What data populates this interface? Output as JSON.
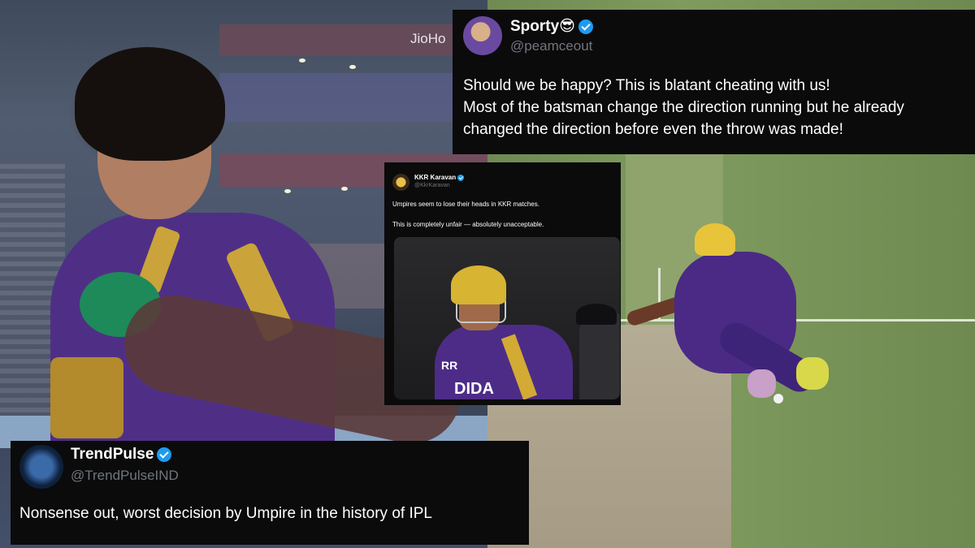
{
  "overlay_text": {
    "jio_watermark": "JioHo"
  },
  "tweets": [
    {
      "name": "Sporty😎",
      "handle": "@peamceout",
      "verified": true,
      "lines": [
        "Should we be happy? This is blatant cheating with us!",
        "Most of the batsman change the direction running but he already",
        "changed the direction before even the throw was made!"
      ]
    },
    {
      "name": "KKR Karavan",
      "handle": "@KkrKaravan",
      "verified": true,
      "lines": [
        "Umpires seem to lose their heads in KKR matches.",
        "This is completely unfair — absolutely unacceptable."
      ],
      "media_text": {
        "sponsor": "DIDA",
        "sponsor_small": "RR"
      }
    },
    {
      "name": "TrendPulse",
      "handle": "@TrendPulseIND",
      "verified": true,
      "lines": [
        "Nonsense out, worst decision by Umpire in the history of IPL"
      ]
    }
  ],
  "colors": {
    "card_bg": "#0b0b0c",
    "verified_blue": "#1d9bf0",
    "handle_gray": "#71767b",
    "kkr_purple": "#4f2f86",
    "kkr_gold": "#caa43a"
  },
  "icons": [
    "verified-badge-icon",
    "avatar"
  ]
}
